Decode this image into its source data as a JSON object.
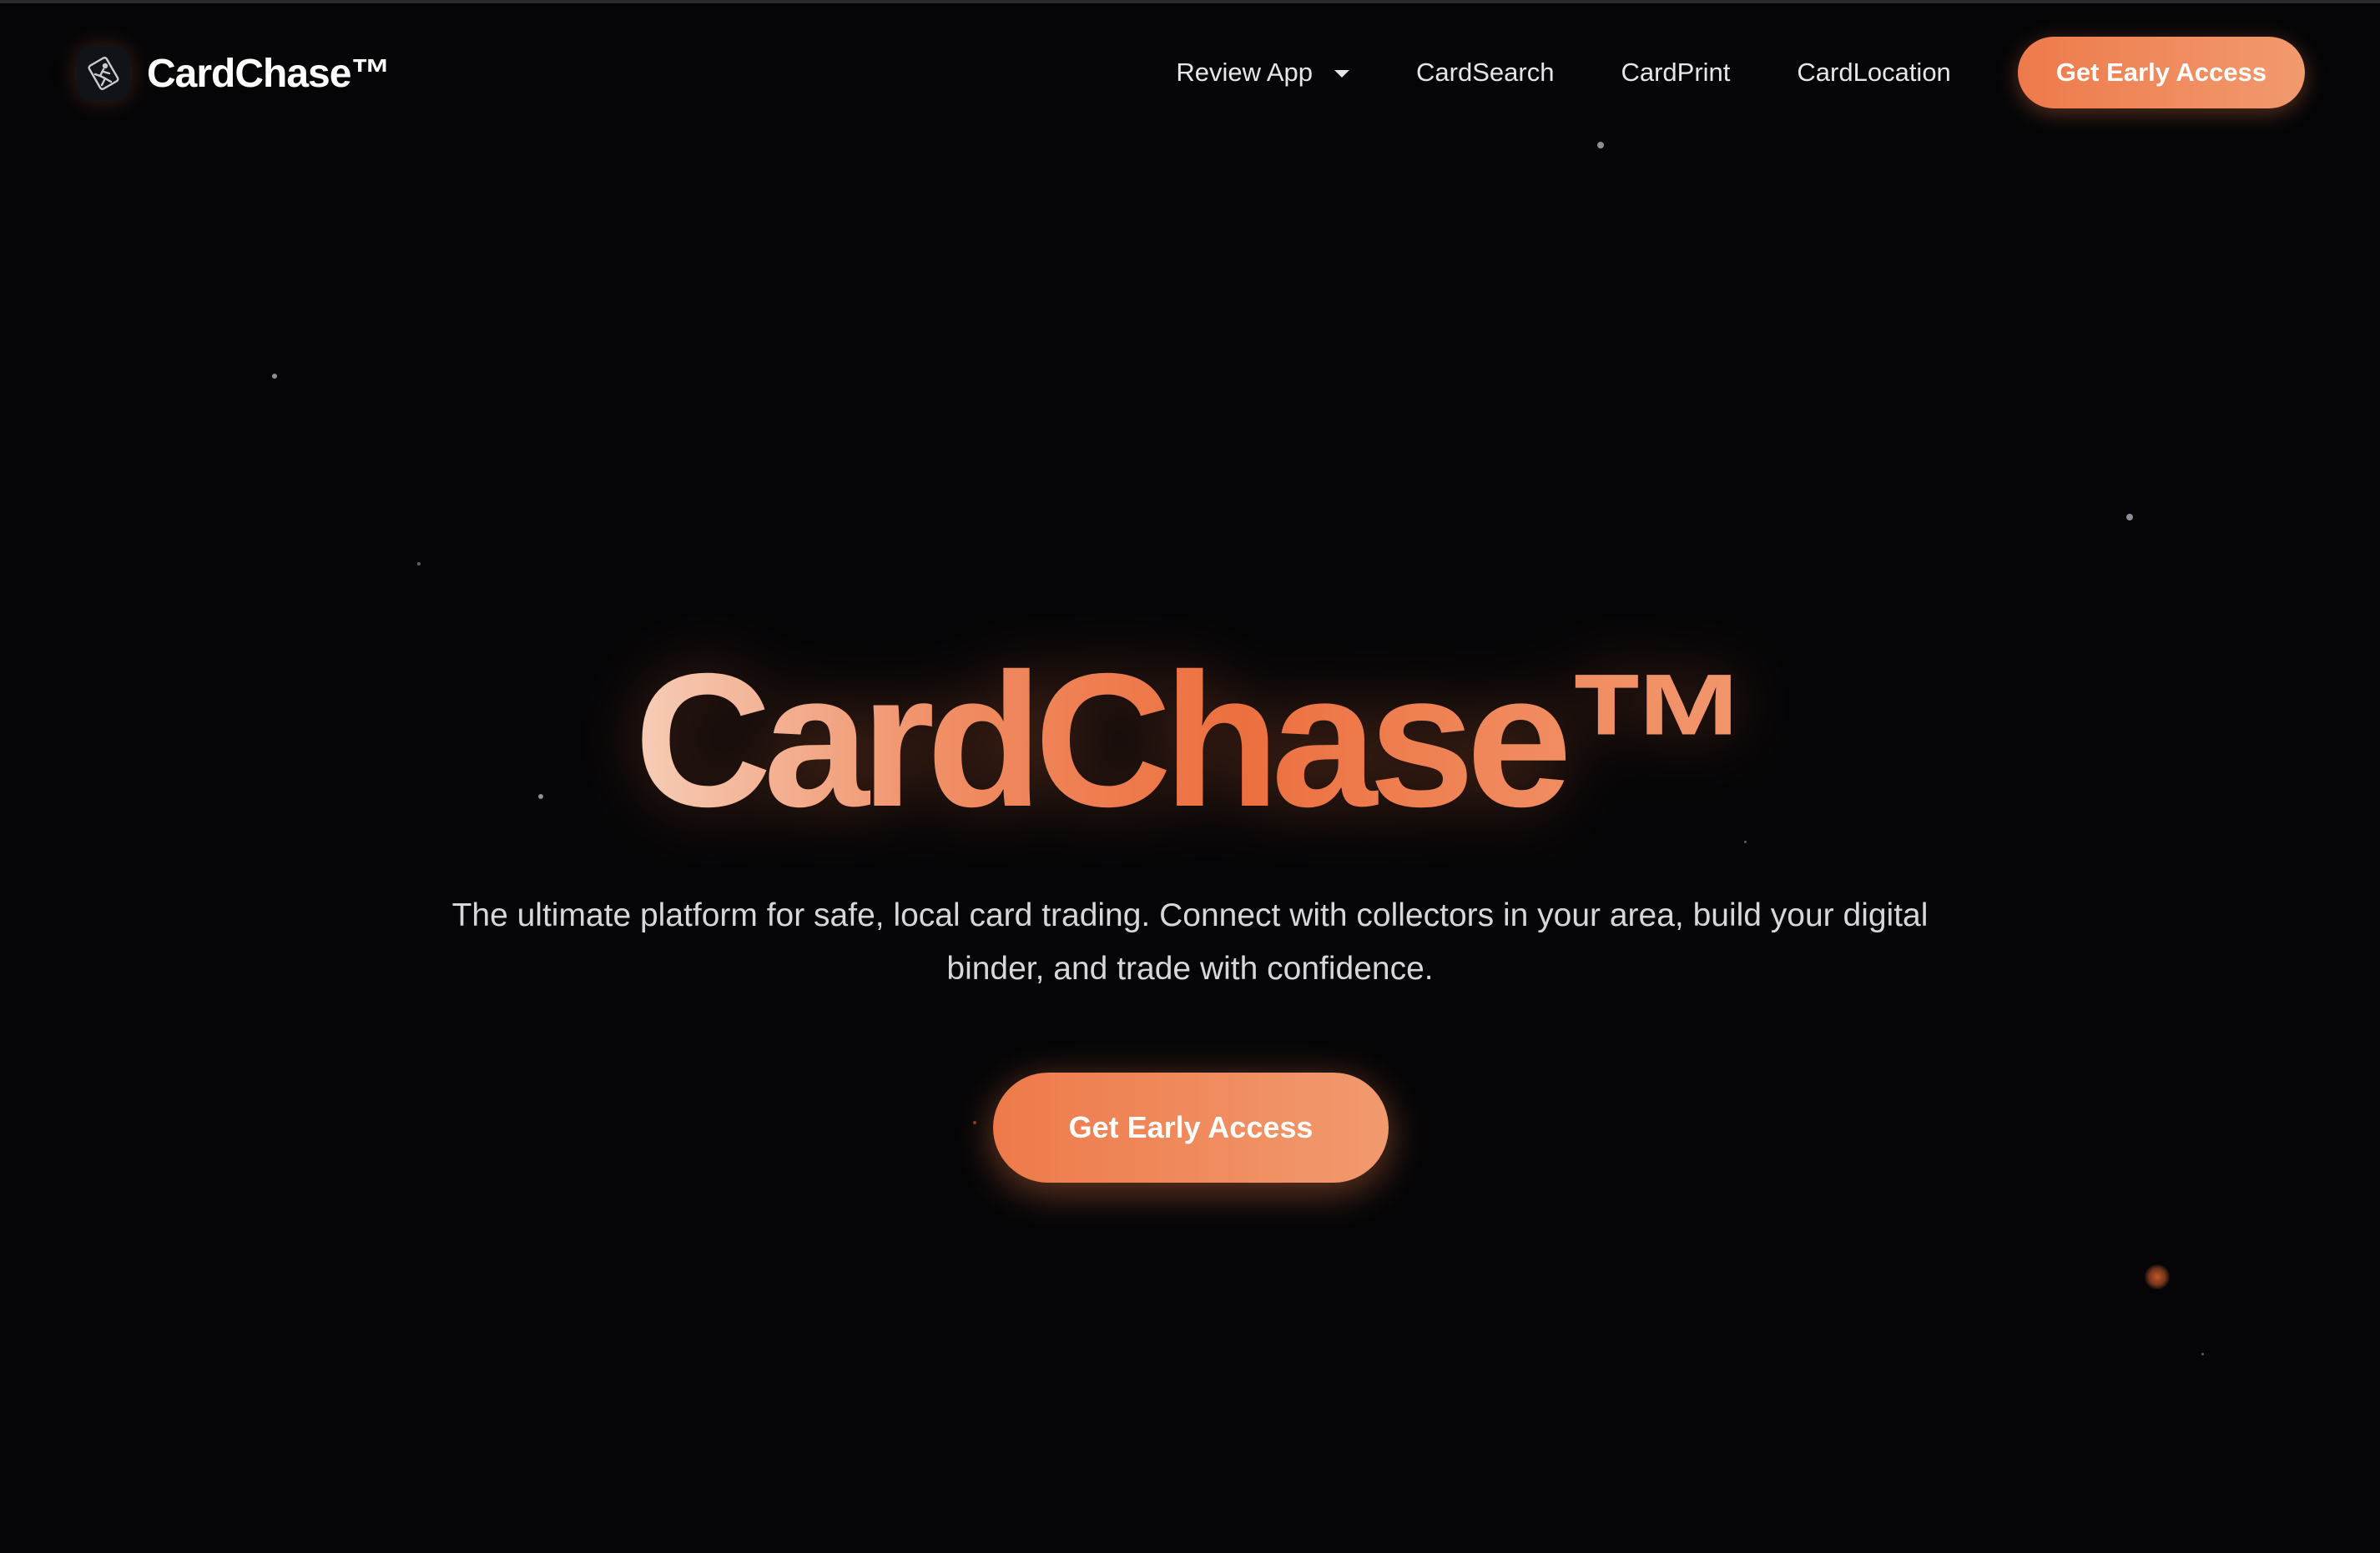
{
  "nav": {
    "brand": "CardChase™",
    "links": [
      {
        "label": "Review App",
        "has_dropdown": true
      },
      {
        "label": "CardSearch"
      },
      {
        "label": "CardPrint"
      },
      {
        "label": "CardLocation"
      }
    ],
    "cta_label": "Get Early Access"
  },
  "hero": {
    "title": "CardChase™",
    "subtitle": "The ultimate platform for safe, local card trading. Connect with collectors in your area, build your digital binder, and trade with confidence.",
    "cta_label": "Get Early Access"
  },
  "colors": {
    "background": "#050507",
    "accent": "#ee7a4b",
    "accent_light": "#f19a6e"
  },
  "icons": {
    "logo": "card-runner-icon",
    "dropdown": "caret-down-icon"
  }
}
